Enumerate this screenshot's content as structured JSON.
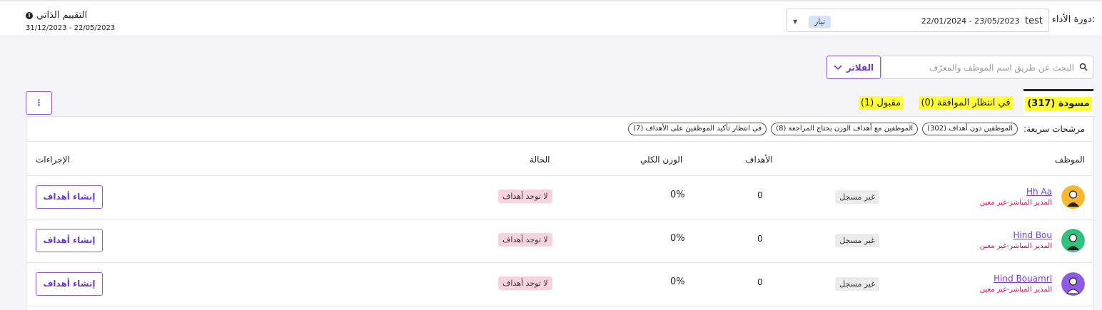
{
  "header": {
    "cycle_label": "دورة الأداء:",
    "cycle_name": "test",
    "cycle_dates": "22/01/2024 - 23/05/2023",
    "cycle_badge": "تيار",
    "self_eval_title": "التقييم الذاتي",
    "self_eval_dates": "31/12/2023 - 22/05/2023"
  },
  "search": {
    "placeholder": "البحث عن طريق اسم الموظف والمعرّف"
  },
  "filters": {
    "label": "الفلاتر"
  },
  "menu": {
    "label": "⋮"
  },
  "tabs": [
    {
      "label": "مسودة (317)"
    },
    {
      "label": "في انتظار الموافقة (0)"
    },
    {
      "label": "مقبول (1)"
    }
  ],
  "quick_filters": {
    "label": "مرشحات سريعة:",
    "chips": [
      "الموظفين دون أهداف (302)",
      "الموظفين مع أهداف الوزن يحتاج المراجعة (8)",
      "في انتظار تأكيد الموظفين على الأهداف (7)"
    ]
  },
  "table": {
    "headers": {
      "employee": "الموظف",
      "goals": "الأهداف",
      "weight": "الوزن الكلي",
      "status": "الحالة",
      "actions": "الإجراءات"
    },
    "rows": [
      {
        "name": "Hh Aa",
        "manager": "المدير المباشر-غير معين",
        "registration": "غير مسجل",
        "goals": "0",
        "weight": "0%",
        "status": "لا توجد أهداف",
        "action": "إنشاء أهداف"
      },
      {
        "name": "Hind Bou",
        "manager": "المدير المباشر-غير معين",
        "registration": "غير مسجل",
        "goals": "0",
        "weight": "0%",
        "status": "لا توجد أهداف",
        "action": "إنشاء أهداف"
      },
      {
        "name": "Hind Bouamri",
        "manager": "المدير المباشر-غير معين",
        "registration": "غير مسجل",
        "goals": "0",
        "weight": "0%",
        "status": "لا توجد أهداف",
        "action": "إنشاء أهداف"
      }
    ]
  },
  "colors": {
    "accent": "#7a3cd0",
    "highlight": "#ffff33",
    "status_bg": "#f6d3de",
    "manager_text": "#c2185b"
  },
  "avatars": [
    {
      "icon": "user-avatar-icon",
      "bg": "#f5b82e"
    },
    {
      "icon": "user-avatar-icon",
      "bg": "#2ec27e"
    },
    {
      "icon": "user-avatar-icon",
      "bg": "#8f5ae8"
    }
  ]
}
